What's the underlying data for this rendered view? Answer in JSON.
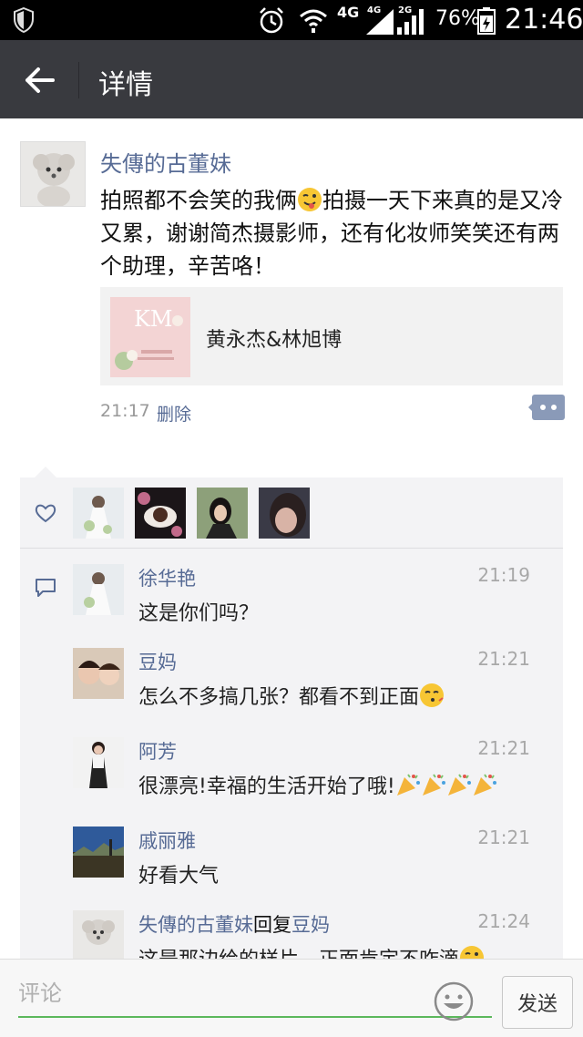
{
  "status_bar": {
    "network": "4G",
    "sig1_label": "4G",
    "sig2_label": "2G",
    "battery": "76%",
    "time": "21:46",
    "icons": [
      "shield-icon",
      "alarm-icon",
      "wifi-icon",
      "signal-icon",
      "battery-icon"
    ]
  },
  "header": {
    "back_icon": "back-arrow-icon",
    "title": "详情"
  },
  "post": {
    "author": "失傳的古董妹",
    "text_parts": [
      "拍照都不会笑的我俩",
      "拍摄一天下来真的是又冷又累，谢谢简杰摄影师，还有化妆师笑笑还有两个助理，辛苦咯！"
    ],
    "link": {
      "thumb_text": "KM",
      "title": "黄永杰&林旭博"
    },
    "time": "21:17",
    "delete_label": "删除"
  },
  "likes": {
    "icon": "heart-icon",
    "count": 4
  },
  "comments": [
    {
      "name": "徐华艳",
      "time": "21:19",
      "text": "这是你们吗？"
    },
    {
      "name": "豆妈",
      "time": "21:21",
      "text": "怎么不多搞几张？都看不到正面"
    },
    {
      "name": "阿芳",
      "time": "21:21",
      "text": "很漂亮!幸福的生活开始了哦!"
    },
    {
      "name": "戚丽雅",
      "time": "21:21",
      "text": "好看大气"
    },
    {
      "name": "失傳的古董妹",
      "reply_word": "回复",
      "reply_to": "豆妈",
      "time": "21:24",
      "text": "这是那边给的样片，正面肯定不咋滴"
    }
  ],
  "input": {
    "placeholder": "评论",
    "send_label": "发送"
  },
  "colors": {
    "link_blue": "#576b95",
    "header_bg": "#393a3f",
    "accent_green": "#5cb85c"
  }
}
